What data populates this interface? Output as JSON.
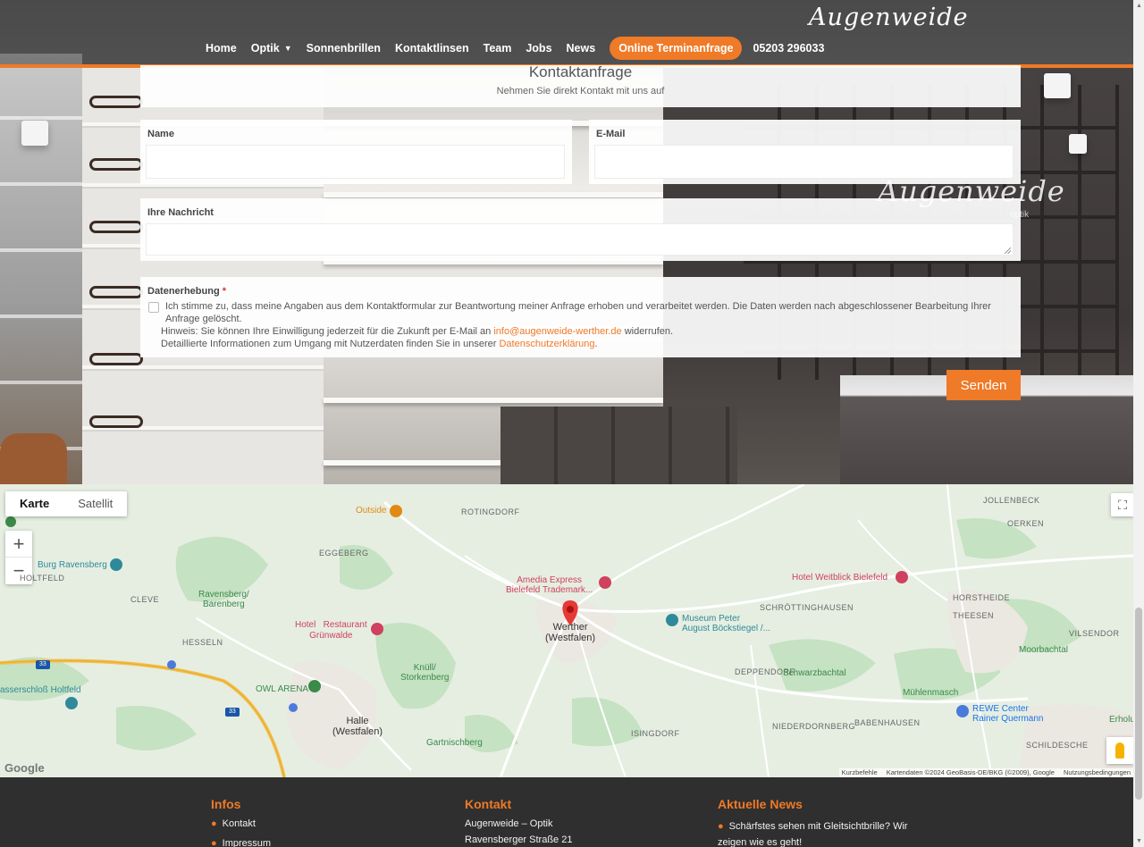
{
  "brand": {
    "logo": "Augenweide",
    "wall_logo": "Augenweide",
    "wall_sub": "optik",
    "accent": "#ef7a27"
  },
  "nav": {
    "items": [
      "Home",
      "Optik",
      "Sonnenbrillen",
      "Kontaktlinsen",
      "Team",
      "Jobs",
      "News"
    ],
    "cta": "Online Terminanfrage",
    "phone": "05203 296033"
  },
  "form": {
    "title": "Kontaktanfrage",
    "subtitle": "Nehmen Sie direkt Kontakt mit uns auf",
    "name_label": "Name",
    "email_label": "E-Mail",
    "message_label": "Ihre Nachricht",
    "consent_label": "Datenerhebung",
    "consent_required": "*",
    "consent_text_1": "Ich stimme zu, dass meine Angaben aus dem Kontaktformular zur Beantwortung meiner Anfrage erhoben und verarbeitet werden. Die Daten werden nach abgeschlossener Bearbeitung Ihrer Anfrage gelöscht.",
    "consent_hint_prefix": "Hinweis: Sie können Ihre Einwilligung jederzeit für die Zukunft per E-Mail an",
    "consent_email": "info@augenweide-werther.de",
    "consent_hint_suffix": "widerrufen.",
    "consent_info_prefix": "Detaillierte Informationen zum Umgang mit Nutzerdaten finden Sie in unserer",
    "consent_privacy_link": "Datenschutzerklärung",
    "consent_info_suffix": ".",
    "submit_label": "Senden"
  },
  "map": {
    "tabs": [
      "Karte",
      "Satellit"
    ],
    "active_tab": "Karte",
    "zoom_in": "+",
    "zoom_out": "−",
    "google": "Google",
    "attribution": [
      "Kurzbefehle",
      "Kartendaten ©2024 GeoBasis-DE/BKG (©2009), Google",
      "Nutzungsbedingungen"
    ],
    "labels": {
      "outside": "Outside",
      "rotingdorf": "ROTINGDORF",
      "jollenbeck": "JOLLENBECK",
      "oerken": "OERKEN",
      "eggeberg": "EGGEBERG",
      "burg": "Burg Ravensberg",
      "holtfeld": "HOLTFELD",
      "amedia": "Amedia Express\nBielefeld Trademark...",
      "weitblick": "Hotel Weitblick Bielefeld",
      "cleve": "CLEVE",
      "ravensberg": "Ravensberg/\nBarenberg",
      "schroettinghausen": "SCHRÖTTINGHAUSEN",
      "horstheide": "HORSTHEIDE",
      "theesen": "THEESEN",
      "hotel_gruenwalde": "Hotel   Restaurant\nGrünwalde",
      "werther": "Werther\n(Westfalen)",
      "museum": "Museum Peter\nAugust Böckstiegel /...",
      "vilsendorf": "VILSENDOR",
      "hesseln": "HESSELN",
      "moorbachtal": "Moorbachtal",
      "knuell": "Knüll/\nStorkenberg",
      "deppendorf": "DEPPENDORF",
      "schwarzbachtal": "Schwarzbachtal",
      "wasserschloss": "asserschloß Holtfeld",
      "owl": "OWL ARENA",
      "muehlenmasch": "Mühlenmasch",
      "rewe": "REWE Center\nRainer Quermann",
      "erholung": "Erholu",
      "halle": "Halle\n(Westfalen)",
      "niederdornberg": "NIEDERDORNBERG",
      "babenhausen": "BABENHAUSEN",
      "schildesche": "SCHILDESCHE",
      "isingdorf": "ISINGDORF",
      "gartnischberg": "Gartnischberg",
      "road33": "33"
    }
  },
  "footer": {
    "infos_title": "Infos",
    "infos_items": [
      "Kontakt",
      "Impressum"
    ],
    "kontakt_title": "Kontakt",
    "kontakt_lines": [
      "Augenweide – Optik",
      "Ravensberger Straße 21"
    ],
    "news_title": "Aktuelle News",
    "news_items": [
      "Schärfstes sehen mit Gleitsichtbrille? Wir zeigen wie es geht!"
    ]
  }
}
